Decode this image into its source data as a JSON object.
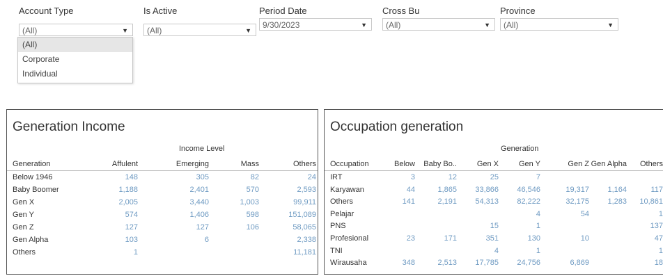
{
  "filters": [
    {
      "label": "Account Type",
      "value": "(All)"
    },
    {
      "label": "Is Active",
      "value": "(All)"
    },
    {
      "label": "Period Date",
      "value": "9/30/2023"
    },
    {
      "label": "Cross Bu",
      "value": "(All)"
    },
    {
      "label": "Province",
      "value": "(All)"
    }
  ],
  "account_type_options": [
    "(All)",
    "Corporate",
    "Individual"
  ],
  "generation_income": {
    "title": "Generation Income",
    "group_header": "Income Level",
    "row_header": "Generation",
    "columns": [
      "Affulent",
      "Emerging",
      "Mass",
      "Others"
    ],
    "rows": [
      {
        "label": "Below 1946",
        "values": [
          "148",
          "305",
          "82",
          "24"
        ]
      },
      {
        "label": "Baby Boomer",
        "values": [
          "1,188",
          "2,401",
          "570",
          "2,593"
        ]
      },
      {
        "label": "Gen X",
        "values": [
          "2,005",
          "3,440",
          "1,003",
          "99,911"
        ]
      },
      {
        "label": "Gen Y",
        "values": [
          "574",
          "1,406",
          "598",
          "151,089"
        ]
      },
      {
        "label": "Gen Z",
        "values": [
          "127",
          "127",
          "106",
          "58,065"
        ]
      },
      {
        "label": "Gen Alpha",
        "values": [
          "103",
          "6",
          "",
          "2,338"
        ]
      },
      {
        "label": "Others",
        "values": [
          "1",
          "",
          "",
          "11,181"
        ]
      }
    ]
  },
  "occupation_generation": {
    "title": "Occupation generation",
    "group_header": "Generation",
    "row_header": "Occupation",
    "columns": [
      "Below",
      "Baby Bo..",
      "Gen X",
      "Gen Y",
      "Gen Z",
      "Gen Alpha",
      "Others"
    ],
    "rows": [
      {
        "label": "IRT",
        "values": [
          "3",
          "12",
          "25",
          "7",
          "",
          "",
          ""
        ]
      },
      {
        "label": "Karyawan",
        "values": [
          "44",
          "1,865",
          "33,866",
          "46,546",
          "19,317",
          "1,164",
          "117"
        ]
      },
      {
        "label": "Others",
        "values": [
          "141",
          "2,191",
          "54,313",
          "82,222",
          "32,175",
          "1,283",
          "10,861"
        ]
      },
      {
        "label": "Pelajar",
        "values": [
          "",
          "",
          "",
          "4",
          "54",
          "",
          "1"
        ]
      },
      {
        "label": "PNS",
        "values": [
          "",
          "",
          "15",
          "1",
          "",
          "",
          "137"
        ]
      },
      {
        "label": "Profesional",
        "values": [
          "23",
          "171",
          "351",
          "130",
          "10",
          "",
          "47"
        ]
      },
      {
        "label": "TNI",
        "values": [
          "",
          "",
          "4",
          "1",
          "",
          "",
          "1"
        ]
      },
      {
        "label": "Wirausaha",
        "values": [
          "348",
          "2,513",
          "17,785",
          "24,756",
          "6,869",
          "",
          "18"
        ]
      }
    ]
  }
}
